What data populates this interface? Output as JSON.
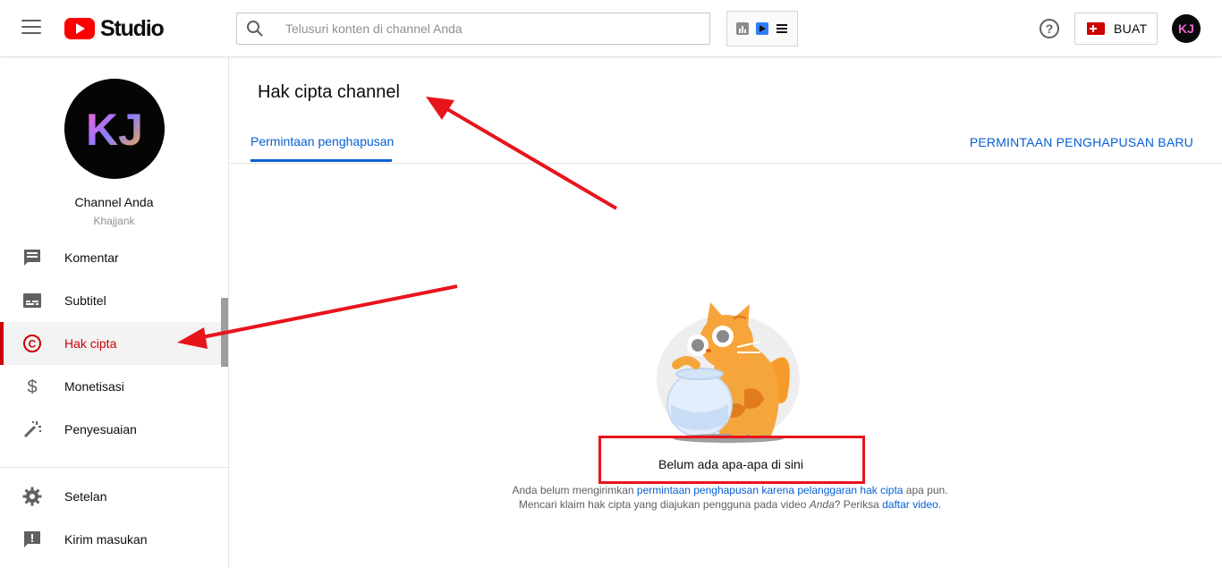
{
  "header": {
    "logo_text": "Studio",
    "search_placeholder": "Telusuri konten di channel Anda",
    "create_label": "BUAT",
    "help_icon": "help-icon",
    "colors": {
      "brand": "#ff0000",
      "accent": "#065fd4",
      "active": "#cc0000"
    }
  },
  "sidebar": {
    "channel_name": "Channel Anda",
    "channel_handle": "Khajjank",
    "avatar_text": "KJ",
    "items": [
      {
        "label": "Komentar",
        "icon": "comment-icon"
      },
      {
        "label": "Subtitel",
        "icon": "subtitles-icon"
      },
      {
        "label": "Hak cipta",
        "icon": "copyright-icon",
        "active": true
      },
      {
        "label": "Monetisasi",
        "icon": "dollar-icon"
      },
      {
        "label": "Penyesuaian",
        "icon": "magic-wand-icon"
      }
    ],
    "bottom_items": [
      {
        "label": "Setelan",
        "icon": "gear-icon"
      },
      {
        "label": "Kirim masukan",
        "icon": "feedback-icon"
      }
    ]
  },
  "main": {
    "title": "Hak cipta channel",
    "tabs": [
      {
        "label": "Permintaan penghapusan",
        "active": true
      }
    ],
    "new_request_label": "PERMINTAAN PENGHAPUSAN BARU",
    "empty_state": {
      "title": "Belum ada apa-apa di sini",
      "line1_prefix": "Anda belum mengirimkan ",
      "line1_link": "permintaan penghapusan karena pelanggaran hak cipta",
      "line1_suffix": " apa pun.",
      "line2_prefix": "Mencari klaim hak cipta yang diajukan pengguna pada video ",
      "line2_italic": "Anda",
      "line2_middle": "? Periksa ",
      "line2_link": "daftar video",
      "line2_suffix": "."
    }
  }
}
